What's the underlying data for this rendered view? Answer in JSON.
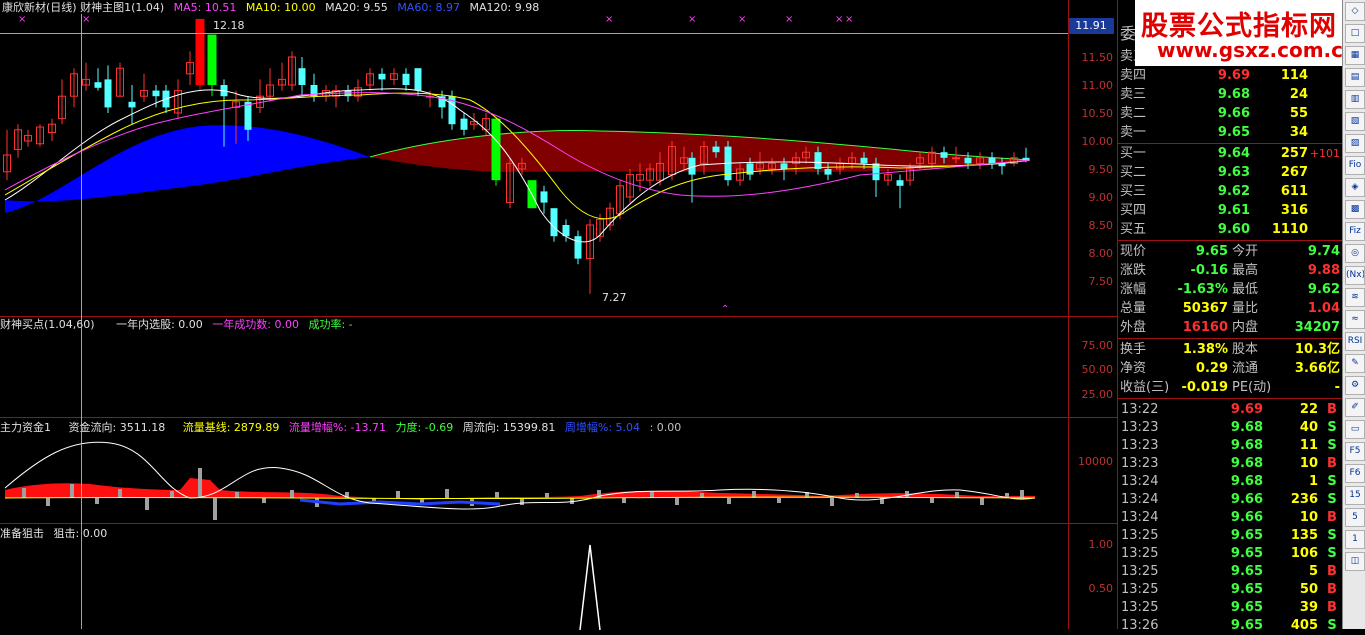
{
  "main_header": {
    "title": "康欣新材(日线) 财神主图1(1.04)",
    "ma5": "MA5: 10.51",
    "ma10": "MA10: 10.00",
    "ma20": "MA20: 9.55",
    "ma60": "MA60: 8.97",
    "ma120": "MA120: 9.98"
  },
  "main_chart": {
    "price_axis": [
      "11.50",
      "11.00",
      "10.50",
      "10.00",
      "9.50",
      "9.00",
      "8.50",
      "8.00",
      "7.50"
    ],
    "current_price_tag": "11.91",
    "high_label": "12.18",
    "low_label": "7.27",
    "colors": {
      "up": "#ff3232",
      "down": "#54ffff",
      "big_up": "#ff0000",
      "big_down": "#00ff00",
      "cloud_blue": "#0000ff",
      "cloud_red": "#800000"
    }
  },
  "panel2": {
    "title": "财神买点(1.04,60)",
    "stat1": "一年内选股: 0.00",
    "stat2": "一年成功数: 0.00",
    "stat3": "成功率: -",
    "axis": [
      "75.00",
      "50.00",
      "25.00"
    ]
  },
  "panel3": {
    "title": "主力资金1",
    "v1": "资金流向: 3511.18",
    "v2": "流量基线: 2879.89",
    "v3": "流量增幅%: -13.71",
    "v4": "力度: -0.69",
    "v5": "周流向: 15399.81",
    "v6": "周增幅%: 5.04",
    "v7": ": 0.00",
    "axis": [
      "10000"
    ]
  },
  "panel4": {
    "title": "准备狙击",
    "v1": "狙击: 0.00",
    "axis": [
      "1.00",
      "0.50"
    ]
  },
  "watermark": {
    "line1": "股票公式指标网",
    "line2": "www.gsxz.com.cn"
  },
  "order_book": {
    "header_label": "委",
    "sells": [
      {
        "label": "卖五",
        "price": "",
        "vol": ""
      },
      {
        "label": "卖四",
        "price": "9.69",
        "vol": "114"
      },
      {
        "label": "卖三",
        "price": "9.68",
        "vol": "24"
      },
      {
        "label": "卖二",
        "price": "9.66",
        "vol": "55"
      },
      {
        "label": "卖一",
        "price": "9.65",
        "vol": "34"
      }
    ],
    "buys": [
      {
        "label": "买一",
        "price": "9.64",
        "vol": "257",
        "chg": "+101"
      },
      {
        "label": "买二",
        "price": "9.63",
        "vol": "267",
        "chg": ""
      },
      {
        "label": "买三",
        "price": "9.62",
        "vol": "611",
        "chg": ""
      },
      {
        "label": "买四",
        "price": "9.61",
        "vol": "316",
        "chg": ""
      },
      {
        "label": "买五",
        "price": "9.60",
        "vol": "1110",
        "chg": ""
      }
    ]
  },
  "quote": {
    "rows1": [
      {
        "l1": "现价",
        "v1": "9.65",
        "l2": "今开",
        "v2": "9.74"
      },
      {
        "l1": "涨跌",
        "v1": "-0.16",
        "l2": "最高",
        "v2": "9.88"
      },
      {
        "l1": "涨幅",
        "v1": "-1.63%",
        "l2": "最低",
        "v2": "9.62"
      },
      {
        "l1": "总量",
        "v1": "50367",
        "l2": "量比",
        "v2": "1.04"
      },
      {
        "l1": "外盘",
        "v1": "16160",
        "l2": "内盘",
        "v2": "34207"
      }
    ],
    "rows2": [
      {
        "l1": "换手",
        "v1": "1.38%",
        "l2": "股本",
        "v2": "10.3亿"
      },
      {
        "l1": "净资",
        "v1": "0.29",
        "l2": "流通",
        "v2": "3.66亿"
      },
      {
        "l1": "收益(三)",
        "v1": "-0.019",
        "l2": "PE(动)",
        "v2": "-"
      }
    ]
  },
  "ticks": [
    {
      "time": "13:22",
      "price": "9.69",
      "vol": "22",
      "side": "B"
    },
    {
      "time": "13:23",
      "price": "9.68",
      "vol": "40",
      "side": "S"
    },
    {
      "time": "13:23",
      "price": "9.68",
      "vol": "11",
      "side": "S"
    },
    {
      "time": "13:23",
      "price": "9.68",
      "vol": "10",
      "side": "B"
    },
    {
      "time": "13:24",
      "price": "9.68",
      "vol": "1",
      "side": "S"
    },
    {
      "time": "13:24",
      "price": "9.66",
      "vol": "236",
      "side": "S"
    },
    {
      "time": "13:24",
      "price": "9.66",
      "vol": "10",
      "side": "B"
    },
    {
      "time": "13:25",
      "price": "9.65",
      "vol": "135",
      "side": "S"
    },
    {
      "time": "13:25",
      "price": "9.65",
      "vol": "106",
      "side": "S"
    },
    {
      "time": "13:25",
      "price": "9.65",
      "vol": "5",
      "side": "B"
    },
    {
      "time": "13:25",
      "price": "9.65",
      "vol": "50",
      "side": "B"
    },
    {
      "time": "13:25",
      "price": "9.65",
      "vol": "39",
      "side": "B"
    },
    {
      "time": "13:26",
      "price": "9.65",
      "vol": "405",
      "side": "S"
    }
  ],
  "toolbar": [
    "◇",
    "□",
    "▦",
    "▤",
    "▥",
    "▧",
    "▨",
    "Fio",
    "◈",
    "▩",
    "Fiz",
    "◎",
    "(Nx)",
    "≋",
    "≈",
    "RSI",
    "✎",
    "⚙",
    "✐",
    "▭",
    "F5",
    "F6",
    "15",
    "5",
    "1",
    "◫"
  ]
}
